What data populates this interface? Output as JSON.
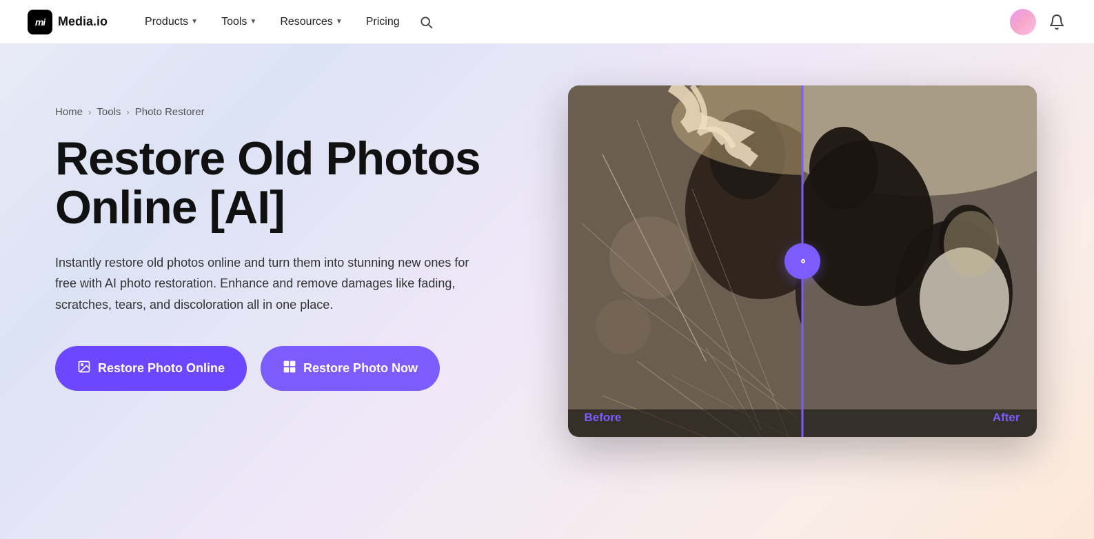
{
  "site": {
    "logo_text": "mi",
    "logo_name": "Media.io",
    "logo_full": "Media.io"
  },
  "navbar": {
    "products_label": "Products",
    "tools_label": "Tools",
    "resources_label": "Resources",
    "pricing_label": "Pricing"
  },
  "breadcrumb": {
    "home": "Home",
    "tools": "Tools",
    "current": "Photo Restorer"
  },
  "hero": {
    "title": "Restore Old Photos Online [AI]",
    "description": "Instantly restore old photos online and turn them into stunning new ones for free with AI photo restoration. Enhance and remove damages like fading, scratches, tears, and discoloration all in one place.",
    "btn_online_label": "Restore Photo Online",
    "btn_now_label": "Restore Photo Now"
  },
  "compare": {
    "before_label": "Before",
    "after_label": "After",
    "handle_icon": "‹›"
  }
}
